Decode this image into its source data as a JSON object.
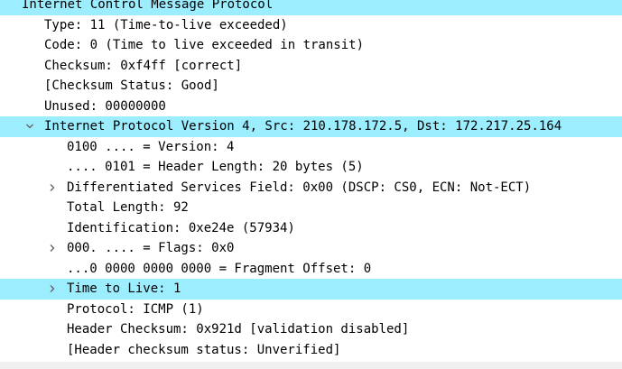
{
  "colors": {
    "highlight": "#9ceeff",
    "text": "#000000",
    "arrow": "#606060"
  },
  "tree": [
    {
      "id": "icmp",
      "text": "Internet Control Message Protocol",
      "depth": 0,
      "arrow": "none",
      "highlight": true
    },
    {
      "id": "icmp-type",
      "text": "Type: 11 (Time-to-live exceeded)",
      "depth": 1,
      "arrow": "none",
      "highlight": false
    },
    {
      "id": "icmp-code",
      "text": "Code: 0 (Time to live exceeded in transit)",
      "depth": 1,
      "arrow": "none",
      "highlight": false
    },
    {
      "id": "icmp-checksum",
      "text": "Checksum: 0xf4ff [correct]",
      "depth": 1,
      "arrow": "none",
      "highlight": false
    },
    {
      "id": "icmp-checksum-status",
      "text": "[Checksum Status: Good]",
      "depth": 1,
      "arrow": "none",
      "highlight": false
    },
    {
      "id": "icmp-unused",
      "text": "Unused: 00000000",
      "depth": 1,
      "arrow": "none",
      "highlight": false
    },
    {
      "id": "ipv4",
      "text": "Internet Protocol Version 4, Src: 210.178.172.5, Dst: 172.217.25.164",
      "depth": 1,
      "arrow": "expanded",
      "highlight": true
    },
    {
      "id": "ip-version",
      "text": "0100 .... = Version: 4",
      "depth": 2,
      "arrow": "none",
      "highlight": false
    },
    {
      "id": "ip-header-length",
      "text": ".... 0101 = Header Length: 20 bytes (5)",
      "depth": 2,
      "arrow": "none",
      "highlight": false
    },
    {
      "id": "ip-dsfield",
      "text": "Differentiated Services Field: 0x00 (DSCP: CS0, ECN: Not-ECT)",
      "depth": 2,
      "arrow": "collapsed",
      "highlight": false
    },
    {
      "id": "ip-total-length",
      "text": "Total Length: 92",
      "depth": 2,
      "arrow": "none",
      "highlight": false
    },
    {
      "id": "ip-identification",
      "text": "Identification: 0xe24e (57934)",
      "depth": 2,
      "arrow": "none",
      "highlight": false
    },
    {
      "id": "ip-flags",
      "text": "000. .... = Flags: 0x0",
      "depth": 2,
      "arrow": "collapsed",
      "highlight": false
    },
    {
      "id": "ip-fragment-offset",
      "text": "...0 0000 0000 0000 = Fragment Offset: 0",
      "depth": 2,
      "arrow": "none",
      "highlight": false
    },
    {
      "id": "ip-ttl",
      "text": "Time to Live: 1",
      "depth": 2,
      "arrow": "collapsed",
      "highlight": true
    },
    {
      "id": "ip-protocol",
      "text": "Protocol: ICMP (1)",
      "depth": 2,
      "arrow": "none",
      "highlight": false
    },
    {
      "id": "ip-header-checksum",
      "text": "Header Checksum: 0x921d [validation disabled]",
      "depth": 2,
      "arrow": "none",
      "highlight": false
    },
    {
      "id": "ip-header-checksum-status",
      "text": "[Header checksum status: Unverified]",
      "depth": 2,
      "arrow": "none",
      "highlight": false
    }
  ]
}
